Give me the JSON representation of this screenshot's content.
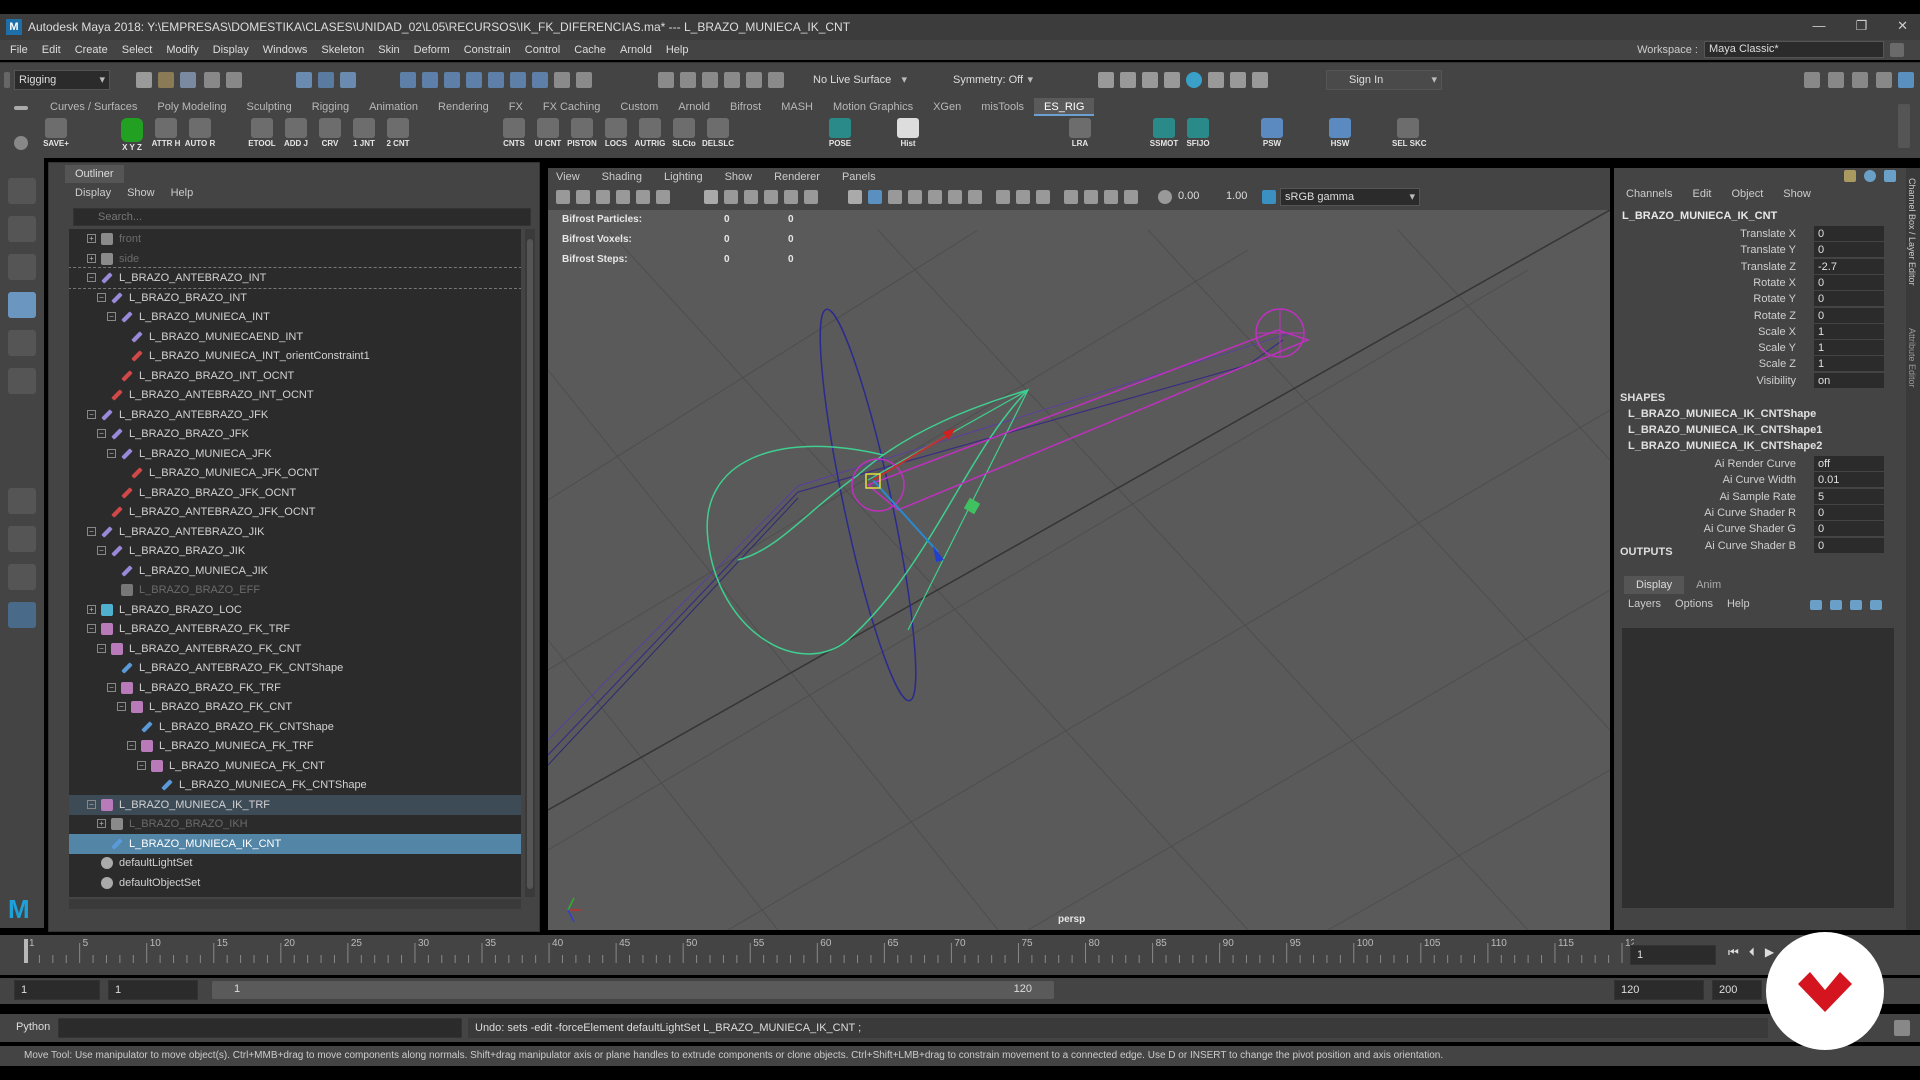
{
  "window": {
    "title": "Autodesk Maya 2018: Y:\\EMPRESAS\\DOMESTIKA\\CLASES\\UNIDAD_02\\L05\\RECURSOS\\IK_FK_DIFERENCIAS.ma*   ---   L_BRAZO_MUNIECA_IK_CNT",
    "logo": "M",
    "controls": [
      "—",
      "❐",
      "✕"
    ]
  },
  "menubar": {
    "items": [
      "File",
      "Edit",
      "Create",
      "Select",
      "Modify",
      "Display",
      "Windows",
      "Skeleton",
      "Skin",
      "Deform",
      "Constrain",
      "Control",
      "Cache",
      "Arnold",
      "Help"
    ],
    "workspace_label": "Workspace :",
    "workspace_value": "Maya Classic*"
  },
  "statusline": {
    "menuset": "Rigging",
    "live_surface": "No Live Surface",
    "symmetry": "Symmetry: Off",
    "sign_in": "Sign In"
  },
  "shelf": {
    "tabs": [
      "Curves / Surfaces",
      "Poly Modeling",
      "Sculpting",
      "Rigging",
      "Animation",
      "Rendering",
      "FX",
      "FX Caching",
      "Custom",
      "Arnold",
      "Bifrost",
      "MASH",
      "Motion Graphics",
      "XGen",
      "misTools",
      "ES_RIG"
    ],
    "active_tab": "ES_RIG",
    "buttons": [
      "SAVE+",
      "X Y Z",
      "ATTR H",
      "AUTO R",
      "ETOOL",
      "ADD J",
      "CRV",
      "1 JNT",
      "2 CNT",
      "CNTS",
      "UI CNT",
      "PISTON",
      "LOCS",
      "AUTRIG",
      "SLCto",
      "DELSLC",
      "POSE",
      "Hist",
      "LRA",
      "SSMOT",
      "SFIJO",
      "PSW",
      "HSW",
      "SEL SKC"
    ]
  },
  "outliner": {
    "title": "Outliner",
    "menu": [
      "Display",
      "Show",
      "Help"
    ],
    "search_placeholder": "Search...",
    "rows": [
      {
        "label": "front",
        "indent": 0,
        "icon": "camera",
        "exp": "+",
        "dim": true
      },
      {
        "label": "side",
        "indent": 0,
        "icon": "camera",
        "exp": "+",
        "dim": true
      },
      {
        "label": "L_BRAZO_ANTEBRAZO_INT",
        "indent": 0,
        "icon": "joint",
        "exp": "−",
        "state": "focus"
      },
      {
        "label": "L_BRAZO_BRAZO_INT",
        "indent": 1,
        "icon": "joint",
        "exp": "−"
      },
      {
        "label": "L_BRAZO_MUNIECA_INT",
        "indent": 2,
        "icon": "joint",
        "exp": "−"
      },
      {
        "label": "L_BRAZO_MUNIECAEND_INT",
        "indent": 3,
        "icon": "joint"
      },
      {
        "label": "L_BRAZO_MUNIECA_INT_orientConstraint1",
        "indent": 3,
        "icon": "constraint"
      },
      {
        "label": "L_BRAZO_BRAZO_INT_OCNT",
        "indent": 2,
        "icon": "constraint"
      },
      {
        "label": "L_BRAZO_ANTEBRAZO_INT_OCNT",
        "indent": 1,
        "icon": "constraint"
      },
      {
        "label": "L_BRAZO_ANTEBRAZO_JFK",
        "indent": 0,
        "icon": "joint",
        "exp": "−"
      },
      {
        "label": "L_BRAZO_BRAZO_JFK",
        "indent": 1,
        "icon": "joint",
        "exp": "−"
      },
      {
        "label": "L_BRAZO_MUNIECA_JFK",
        "indent": 2,
        "icon": "joint",
        "exp": "−"
      },
      {
        "label": "L_BRAZO_MUNIECA_JFK_OCNT",
        "indent": 3,
        "icon": "constraint"
      },
      {
        "label": "L_BRAZO_BRAZO_JFK_OCNT",
        "indent": 2,
        "icon": "constraint"
      },
      {
        "label": "L_BRAZO_ANTEBRAZO_JFK_OCNT",
        "indent": 1,
        "icon": "constraint"
      },
      {
        "label": "L_BRAZO_ANTEBRAZO_JIK",
        "indent": 0,
        "icon": "joint",
        "exp": "−"
      },
      {
        "label": "L_BRAZO_BRAZO_JIK",
        "indent": 1,
        "icon": "joint",
        "exp": "−"
      },
      {
        "label": "L_BRAZO_MUNIECA_JIK",
        "indent": 2,
        "icon": "joint"
      },
      {
        "label": "L_BRAZO_BRAZO_EFF",
        "indent": 2,
        "icon": "effector",
        "dim": true
      },
      {
        "label": "L_BRAZO_BRAZO_LOC",
        "indent": 0,
        "icon": "locator",
        "exp": "+"
      },
      {
        "label": "L_BRAZO_ANTEBRAZO_FK_TRF",
        "indent": 0,
        "icon": "transform",
        "exp": "−"
      },
      {
        "label": "L_BRAZO_ANTEBRAZO_FK_CNT",
        "indent": 1,
        "icon": "transform",
        "exp": "−"
      },
      {
        "label": "L_BRAZO_ANTEBRAZO_FK_CNTShape",
        "indent": 2,
        "icon": "curve"
      },
      {
        "label": "L_BRAZO_BRAZO_FK_TRF",
        "indent": 2,
        "icon": "transform",
        "exp": "−"
      },
      {
        "label": "L_BRAZO_BRAZO_FK_CNT",
        "indent": 3,
        "icon": "transform",
        "exp": "−"
      },
      {
        "label": "L_BRAZO_BRAZO_FK_CNTShape",
        "indent": 4,
        "icon": "curve"
      },
      {
        "label": "L_BRAZO_MUNIECA_FK_TRF",
        "indent": 4,
        "icon": "transform",
        "exp": "−"
      },
      {
        "label": "L_BRAZO_MUNIECA_FK_CNT",
        "indent": 5,
        "icon": "transform",
        "exp": "−"
      },
      {
        "label": "L_BRAZO_MUNIECA_FK_CNTShape",
        "indent": 6,
        "icon": "curve"
      },
      {
        "label": "L_BRAZO_MUNIECA_IK_TRF",
        "indent": 0,
        "icon": "transform",
        "exp": "−",
        "state": "hl"
      },
      {
        "label": "L_BRAZO_BRAZO_IKH",
        "indent": 1,
        "icon": "ikhandle",
        "exp": "+",
        "dim": true
      },
      {
        "label": "L_BRAZO_MUNIECA_IK_CNT",
        "indent": 1,
        "icon": "curve",
        "state": "sel"
      },
      {
        "label": "defaultLightSet",
        "indent": 0,
        "icon": "set"
      },
      {
        "label": "defaultObjectSet",
        "indent": 0,
        "icon": "set"
      }
    ]
  },
  "viewport": {
    "menu": [
      "View",
      "Shading",
      "Lighting",
      "Show",
      "Renderer",
      "Panels"
    ],
    "exposure": "0.00",
    "gamma": "1.00",
    "color_space": "sRGB gamma",
    "hud": [
      {
        "label": "Bifrost Particles:",
        "v1": "0",
        "v2": "0"
      },
      {
        "label": "Bifrost Voxels:",
        "v1": "0",
        "v2": "0"
      },
      {
        "label": "Bifrost Steps:",
        "v1": "0",
        "v2": "0"
      }
    ],
    "camera": "persp"
  },
  "channelbox": {
    "menu": [
      "Channels",
      "Edit",
      "Object",
      "Show"
    ],
    "node": "L_BRAZO_MUNIECA_IK_CNT",
    "channels": [
      {
        "name": "Translate X",
        "value": "0"
      },
      {
        "name": "Translate Y",
        "value": "0"
      },
      {
        "name": "Translate Z",
        "value": "-2.7"
      },
      {
        "name": "Rotate X",
        "value": "0"
      },
      {
        "name": "Rotate Y",
        "value": "0"
      },
      {
        "name": "Rotate Z",
        "value": "0"
      },
      {
        "name": "Scale X",
        "value": "1"
      },
      {
        "name": "Scale Y",
        "value": "1"
      },
      {
        "name": "Scale Z",
        "value": "1"
      },
      {
        "name": "Visibility",
        "value": "on"
      }
    ],
    "shapes_header": "SHAPES",
    "shapes": [
      "L_BRAZO_MUNIECA_IK_CNTShape",
      "L_BRAZO_MUNIECA_IK_CNTShape1",
      "L_BRAZO_MUNIECA_IK_CNTShape2"
    ],
    "shape_attrs": [
      {
        "name": "Ai Render Curve",
        "value": "off"
      },
      {
        "name": "Ai Curve Width",
        "value": "0.01"
      },
      {
        "name": "Ai Sample Rate",
        "value": "5"
      },
      {
        "name": "Ai Curve Shader R",
        "value": "0"
      },
      {
        "name": "Ai Curve Shader G",
        "value": "0"
      },
      {
        "name": "Ai Curve Shader B",
        "value": "0"
      }
    ],
    "outputs_header": "OUTPUTS",
    "layer_tabs": [
      "Display",
      "Anim"
    ],
    "layer_menu": [
      "Layers",
      "Options",
      "Help"
    ]
  },
  "sidetabs": [
    "Channel Box / Layer Editor",
    "Attribute Editor"
  ],
  "timeline": {
    "ticks": [
      "1",
      "5",
      "10",
      "15",
      "20",
      "25",
      "30",
      "35",
      "40",
      "45",
      "50",
      "55",
      "60",
      "65",
      "70",
      "75",
      "80",
      "85",
      "90",
      "95",
      "100",
      "105",
      "110",
      "115",
      "120"
    ],
    "current_frame": "1"
  },
  "range": {
    "start": "1",
    "anim_start": "1",
    "slider_start": "1",
    "slider_end": "120",
    "end": "120",
    "anim_end": "200"
  },
  "cmdline": {
    "lang": "Python",
    "result": "Undo: sets -edit -forceElement  defaultLightSet L_BRAZO_MUNIECA_IK_CNT ;"
  },
  "helpline": "Move Tool: Use manipulator to move object(s). Ctrl+MMB+drag to move components along normals. Shift+drag manipulator axis or plane handles to extrude components or clone objects. Ctrl+Shift+LMB+drag to constrain movement to a connected edge. Use D or INSERT to change the pivot position and axis orientation.",
  "colors": {
    "accent": "#5285a6",
    "selection": "#5285a6",
    "shelf_green": "#22a022",
    "badge_red": "#d4141e"
  }
}
